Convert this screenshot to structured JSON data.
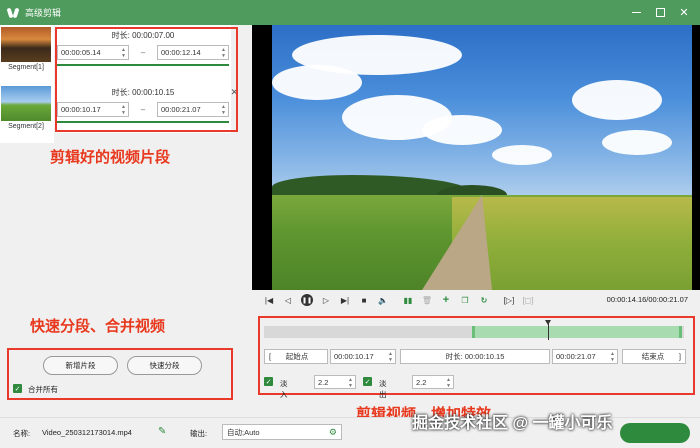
{
  "app": {
    "title": "高级剪辑"
  },
  "thumbnails": [
    {
      "label": "Segment[1]"
    },
    {
      "label": "Segment[2]"
    }
  ],
  "segments": [
    {
      "duration": "时长: 00:00:07.00",
      "start": "00:00:05.14",
      "end": "00:00:12.14"
    },
    {
      "duration": "时长: 00:00:10.15",
      "start": "00:00:10.17",
      "end": "00:00:21.07"
    }
  ],
  "annotations": {
    "clips": "剪辑好的视频片段",
    "split_merge": "快速分段、合并视频",
    "trim_effects": "剪辑视频、增加特效"
  },
  "left_actions": {
    "add_segment": "新增片段",
    "quick_split": "快速分段",
    "merge_all": "合并所有",
    "merge_all_checked": true
  },
  "player": {
    "timecode": "00:00:14.16/00:00:21.07"
  },
  "trim": {
    "start_point_label": "起始点",
    "start_time": "00:00:10.17",
    "duration": "时长: 00:00:10.15",
    "end_time": "00:00:21.07",
    "end_point_label": "结束点",
    "bracket_open": "[",
    "bracket_close": "]",
    "fade_in_label": "淡入",
    "fade_in_value": "2.2",
    "fade_out_label": "淡出",
    "fade_out_value": "2.2"
  },
  "bottom": {
    "name_label": "名称:",
    "file_name": "Video_250312173014.mp4",
    "output_label": "输出:",
    "output_value": "自动;Auto"
  },
  "watermark": "掘金技术社区 @ 一罐小可乐",
  "colors": {
    "accent": "#2e8b3e",
    "titlebar": "#4f9b5e",
    "annotation": "#e8391e"
  }
}
